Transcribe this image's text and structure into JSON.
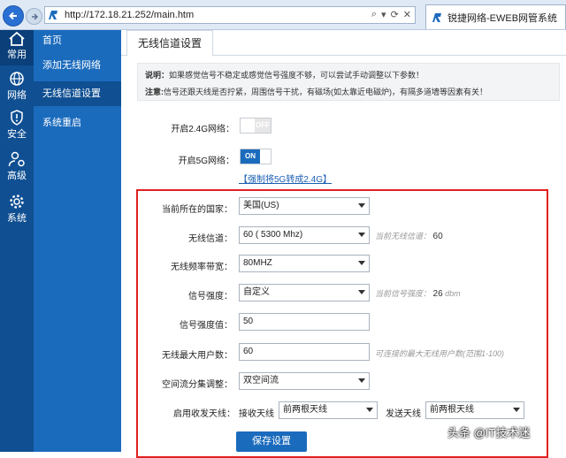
{
  "browser": {
    "url": "http://172.18.21.252/main.htm",
    "tab_title": "锐捷网络-EWEB网管系统",
    "address_tools": [
      "⌕",
      "▾",
      "⟳",
      "✕"
    ]
  },
  "iconbar": [
    {
      "label": "常用",
      "icon": "home-icon"
    },
    {
      "label": "网络",
      "icon": "network-globe-icon"
    },
    {
      "label": "安全",
      "icon": "shield-icon"
    },
    {
      "label": "高级",
      "icon": "user-gear-icon"
    },
    {
      "label": "系统",
      "icon": "gear-icon"
    }
  ],
  "menu": [
    "首页",
    "添加无线网络",
    "无线信道设置",
    "系统重启"
  ],
  "page_tab": "无线信道设置",
  "notice": {
    "line1_title": "说明：",
    "line1_text": "如果感觉信号不稳定或感觉信号强度不够，可以尝试手动调整以下参数！",
    "line2_title": "注意:",
    "line2_text": "信号还跟天线是否拧紧，周围信号干扰，有磁场(如太靠近电磁炉)，有隔多道墙等因素有关！"
  },
  "toggles": {
    "band24_label": "开启2.4G网络：",
    "band24_state": "OFF",
    "band5_label": "开启5G网络：",
    "band5_state": "ON",
    "force_link": "【强制将5G转成2.4G】"
  },
  "form": {
    "country_label": "当前所在的国家：",
    "country_value": "美国(US)",
    "channel_label": "无线信道：",
    "channel_value": "60 ( 5300 Mhz)",
    "channel_hint": "当前无线信道：",
    "channel_hint_value": "60",
    "bandwidth_label": "无线频率带宽：",
    "bandwidth_value": "80MHZ",
    "power_label": "信号强度：",
    "power_value": "自定义",
    "power_hint": "当前信号强度：",
    "power_hint_value": "26",
    "power_hint_unit": "dbm",
    "power_num_label": "信号强度值：",
    "power_num_value": "50",
    "max_users_label": "无线最大用户数：",
    "max_users_value": "60",
    "max_users_hint": "可连接的最大无线用户数(范围1-100)",
    "stream_label": "空间流分集调整：",
    "stream_value": "双空间流",
    "antenna_label": "启用收发天线：",
    "rx_label": "接收天线",
    "rx_value": "前两根天线",
    "tx_label": "发送天线",
    "tx_value": "前两根天线"
  },
  "save_button": "保存设置",
  "watermark": "头条 @IT技术迷",
  "colors": {
    "sidebar_dark": "#0f4f92",
    "sidebar_menu": "#1b6bbd",
    "highlight_box": "#e02020"
  }
}
